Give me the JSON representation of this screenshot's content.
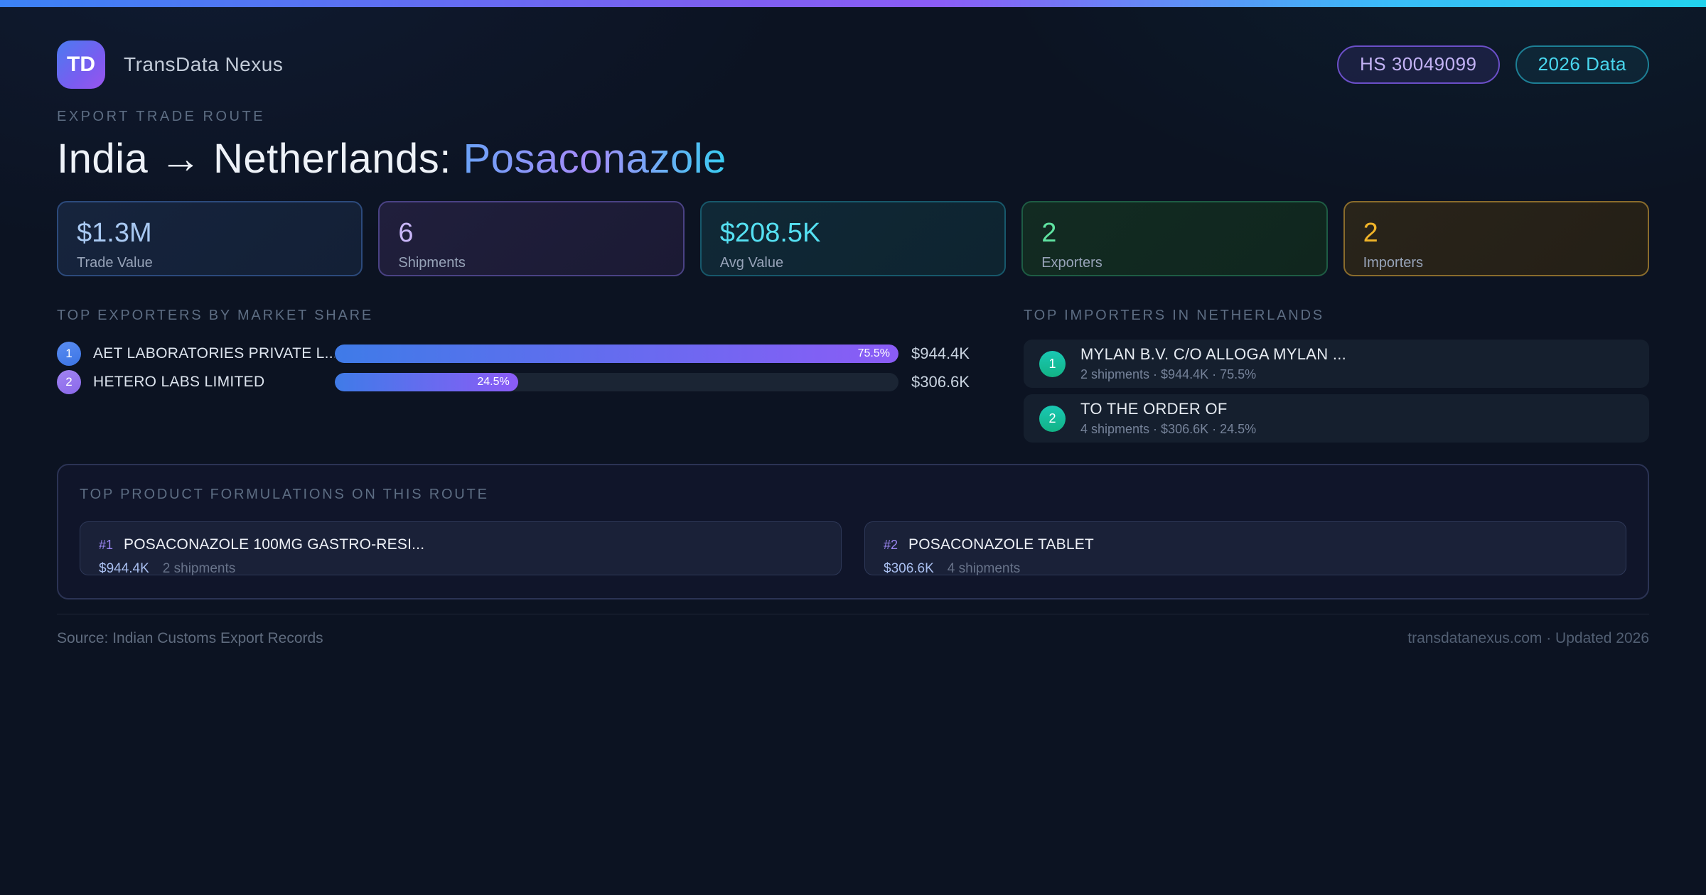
{
  "colors": {
    "page_background": "#0c1322",
    "accent_blue": "#3b82f6",
    "accent_purple": "#8b5cf6",
    "accent_cyan": "#22d3ee",
    "accent_green": "#10b981",
    "accent_amber": "#f0b429"
  },
  "header": {
    "logo_text": "TD",
    "brand": "TransData Nexus",
    "hs_badge": "HS 30049099",
    "year_badge": "2026 Data"
  },
  "hero": {
    "eyebrow": "EXPORT TRADE ROUTE",
    "route_prefix": "India → Netherlands: ",
    "product": "Posaconazole"
  },
  "stats": [
    {
      "value": "$1.3M",
      "label": "Trade Value"
    },
    {
      "value": "6",
      "label": "Shipments"
    },
    {
      "value": "$208.5K",
      "label": "Avg Value"
    },
    {
      "value": "2",
      "label": "Exporters"
    },
    {
      "value": "2",
      "label": "Importers"
    }
  ],
  "exporters": {
    "heading": "TOP EXPORTERS BY MARKET SHARE",
    "rows": [
      {
        "rank": "1",
        "name": "AET LABORATORIES PRIVATE L...",
        "share_label": "75.5%",
        "share_pct": 75.5,
        "value": "$944.4K",
        "bar_width_pct": 100
      },
      {
        "rank": "2",
        "name": "HETERO LABS LIMITED",
        "share_label": "24.5%",
        "share_pct": 24.5,
        "value": "$306.6K",
        "bar_width_pct": 32.5
      }
    ]
  },
  "importers": {
    "heading": "TOP IMPORTERS IN NETHERLANDS",
    "rows": [
      {
        "rank": "1",
        "name": "MYLAN B.V. C/O ALLOGA MYLAN ...",
        "meta": "2 shipments · $944.4K · 75.5%"
      },
      {
        "rank": "2",
        "name": "TO THE ORDER OF",
        "meta": "4 shipments · $306.6K · 24.5%"
      }
    ]
  },
  "formulations": {
    "heading": "TOP PRODUCT FORMULATIONS ON THIS ROUTE",
    "cards": [
      {
        "rank": "#1",
        "name": "POSACONAZOLE 100MG GASTRO-RESI...",
        "value": "$944.4K",
        "shipments": "2 shipments"
      },
      {
        "rank": "#2",
        "name": "POSACONAZOLE TABLET",
        "value": "$306.6K",
        "shipments": "4 shipments"
      }
    ]
  },
  "footer": {
    "source": "Source: Indian Customs Export Records",
    "site": "transdatanexus.com · Updated 2026"
  }
}
